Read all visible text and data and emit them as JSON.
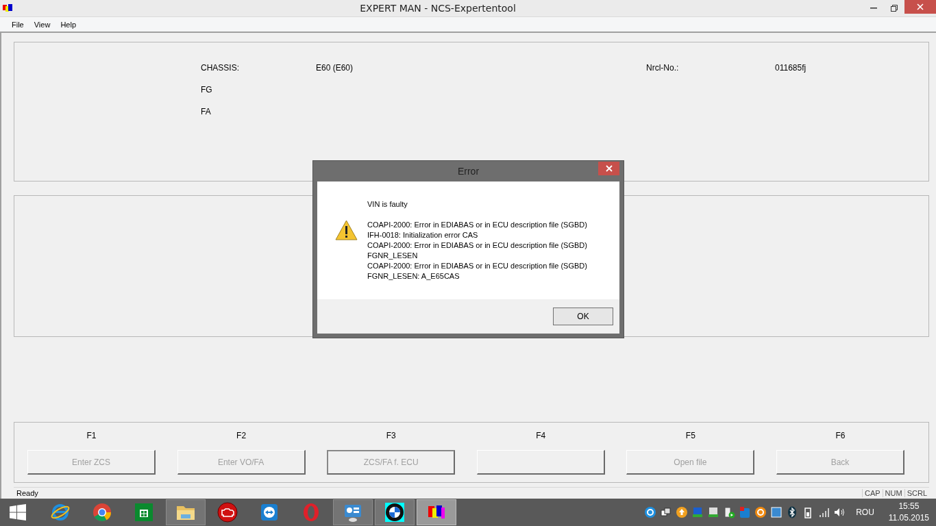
{
  "window": {
    "title": "EXPERT  MAN - NCS-Expertentool"
  },
  "menu": [
    "File",
    "View",
    "Help"
  ],
  "vehicle": {
    "fields": [
      {
        "label": "CHASSIS:",
        "value": "E60 (E60)"
      },
      {
        "label": "FG"
      },
      {
        "label": "FA"
      }
    ],
    "nrcl": {
      "label": "Nrcl-No.:",
      "value": "011685fj"
    }
  },
  "function_keys": [
    {
      "key": "F1",
      "label": "Enter ZCS",
      "disabled": true,
      "focused": false
    },
    {
      "key": "F2",
      "label": "Enter VO/FA",
      "disabled": true,
      "focused": false
    },
    {
      "key": "F3",
      "label": "ZCS/FA f. ECU",
      "disabled": true,
      "focused": true
    },
    {
      "key": "F4",
      "focused": false
    },
    {
      "key": "F5",
      "label": "Open file",
      "disabled": true,
      "focused": false
    },
    {
      "key": "F6",
      "label": "Back",
      "disabled": true,
      "focused": false
    }
  ],
  "status_bar": {
    "text": "Ready",
    "indicators": [
      "CAP",
      "NUM",
      "SCRL"
    ]
  },
  "dialog": {
    "title": "Error",
    "heading": "VIN is faulty",
    "lines": [
      "COAPI-2000: Error in EDIABAS or in ECU description file (SGBD)",
      "IFH-0018: Initialization error  CAS",
      "COAPI-2000: Error in EDIABAS or in ECU description file (SGBD)",
      "FGNR_LESEN",
      "COAPI-2000: Error in EDIABAS or in ECU description file (SGBD)",
      "FGNR_LESEN: A_E65CAS"
    ],
    "button": "OK"
  },
  "taskbar": {
    "apps": [
      {
        "kind": "ie",
        "running": false,
        "selected": false
      },
      {
        "kind": "chrome",
        "running": false,
        "selected": false
      },
      {
        "kind": "store",
        "running": false,
        "selected": false
      },
      {
        "kind": "folder",
        "running": true,
        "selected": false
      },
      {
        "kind": "engine",
        "running": false,
        "selected": false
      },
      {
        "kind": "remote",
        "running": false,
        "selected": false
      },
      {
        "kind": "opera",
        "running": false,
        "selected": false
      },
      {
        "kind": "panel",
        "running": true,
        "selected": false
      },
      {
        "kind": "bmw",
        "running": true,
        "selected": false
      },
      {
        "kind": "ncs",
        "running": true,
        "selected": true
      }
    ],
    "tray": [
      {
        "kind": "ie"
      },
      {
        "kind": "windows"
      },
      {
        "kind": "update"
      },
      {
        "kind": "ediabas"
      },
      {
        "kind": "ediabas2"
      },
      {
        "kind": "server"
      },
      {
        "kind": "remote"
      },
      {
        "kind": "orange"
      },
      {
        "kind": "network"
      },
      {
        "kind": "bluetooth"
      },
      {
        "kind": "battery"
      },
      {
        "kind": "signal"
      },
      {
        "kind": "volume"
      }
    ],
    "language": "ROU",
    "time": "15:55",
    "date": "11.05.2015"
  }
}
